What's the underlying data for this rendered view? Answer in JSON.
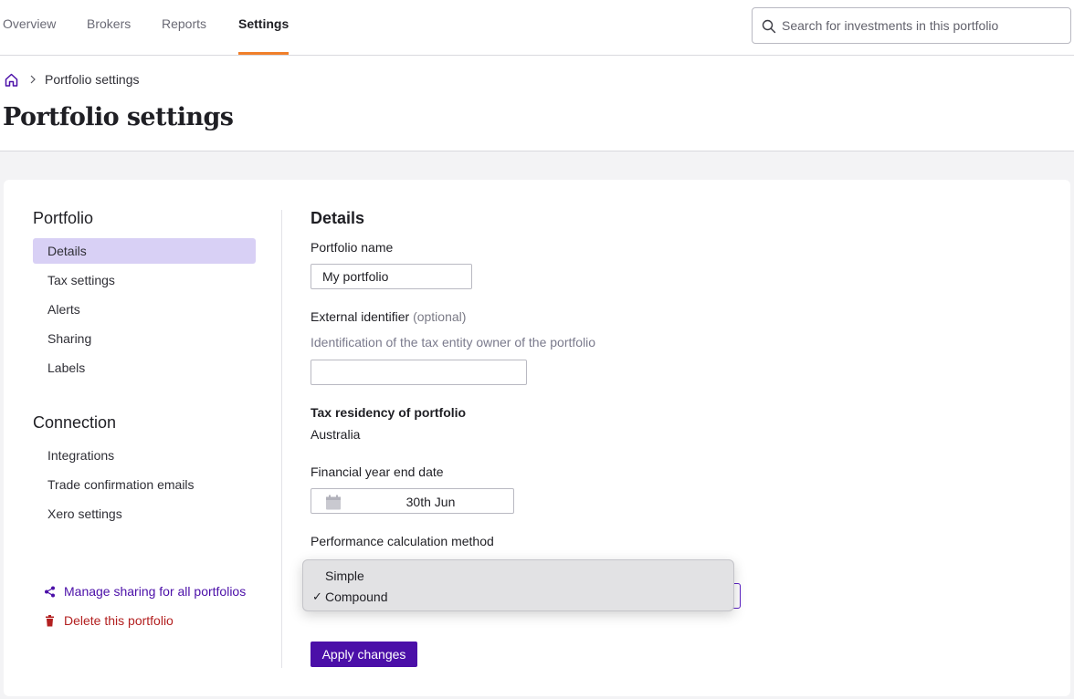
{
  "nav": {
    "tabs": [
      {
        "label": "Overview"
      },
      {
        "label": "Brokers"
      },
      {
        "label": "Reports"
      },
      {
        "label": "Settings",
        "active": true
      }
    ],
    "search_placeholder": "Search for investments in this portfolio"
  },
  "breadcrumb": {
    "current": "Portfolio settings"
  },
  "page_title": "Portfolio settings",
  "sidebar": {
    "portfolio_heading": "Portfolio",
    "portfolio_items": [
      {
        "label": "Details",
        "active": true
      },
      {
        "label": "Tax settings"
      },
      {
        "label": "Alerts"
      },
      {
        "label": "Sharing"
      },
      {
        "label": "Labels"
      }
    ],
    "connection_heading": "Connection",
    "connection_items": [
      {
        "label": "Integrations"
      },
      {
        "label": "Trade confirmation emails"
      },
      {
        "label": "Xero settings"
      }
    ],
    "manage_sharing": "Manage sharing for all portfolios",
    "delete_portfolio": "Delete this portfolio"
  },
  "details": {
    "title": "Details",
    "portfolio_name_label": "Portfolio name",
    "portfolio_name_value": "My portfolio",
    "external_id_label": "External identifier",
    "external_id_optional": "(optional)",
    "external_id_hint": "Identification of the tax entity owner of the portfolio",
    "external_id_value": "",
    "tax_residency_label": "Tax residency of portfolio",
    "tax_residency_value": "Australia",
    "fy_end_label": "Financial year end date",
    "fy_end_value": "30th Jun",
    "perf_method_label": "Performance calculation method",
    "perf_method_options": [
      "Simple",
      "Compound"
    ],
    "perf_method_selected": "Compound",
    "apply_label": "Apply changes"
  },
  "colors": {
    "accent": "#4b0fa8",
    "tab_underline": "#f07f2a",
    "active_item_bg": "#d8d0f5",
    "danger": "#b32020"
  }
}
